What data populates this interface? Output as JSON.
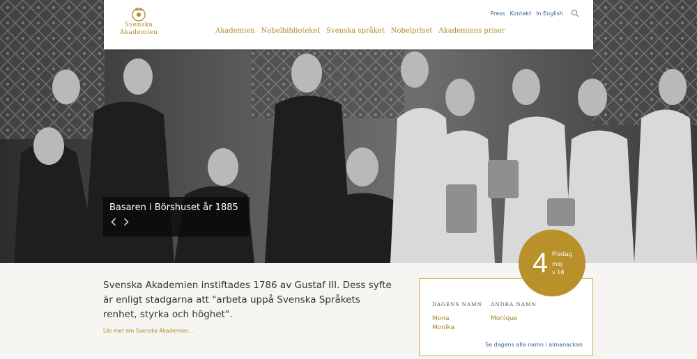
{
  "logo": {
    "line1": "Svenska",
    "line2": "Akademien"
  },
  "utility_nav": [
    "Press",
    "Kontakt",
    "In English"
  ],
  "main_nav": [
    "Akademien",
    "Nobelbiblioteket",
    "Svenska språket",
    "Nobelpriset",
    "Akademiens priser"
  ],
  "hero": {
    "caption": "Basaren i Börshuset år 1885"
  },
  "intro": {
    "text": "Svenska Akademien instiftades 1786 av Gustaf III. Dess syfte är enligt stadgarna att \"arbeta uppå Svenska Språkets renhet, styrka och höghet\".",
    "read_more": "Läs mer om Svenska Akademien..."
  },
  "date": {
    "day": "4",
    "weekday": "Fredag",
    "month": "maj",
    "week": "v 18"
  },
  "namedays": {
    "todays_heading": "DAGENS NAMN",
    "todays": [
      "Mona",
      "Monika"
    ],
    "other_heading": "ANDRA NAMN",
    "other": [
      "Monique"
    ],
    "calendar_link": "Se dagens alla namn i almanackan"
  },
  "colors": {
    "gold": "#b08a2a",
    "link_blue": "#3a5f8f",
    "circle": "#b8912a"
  }
}
